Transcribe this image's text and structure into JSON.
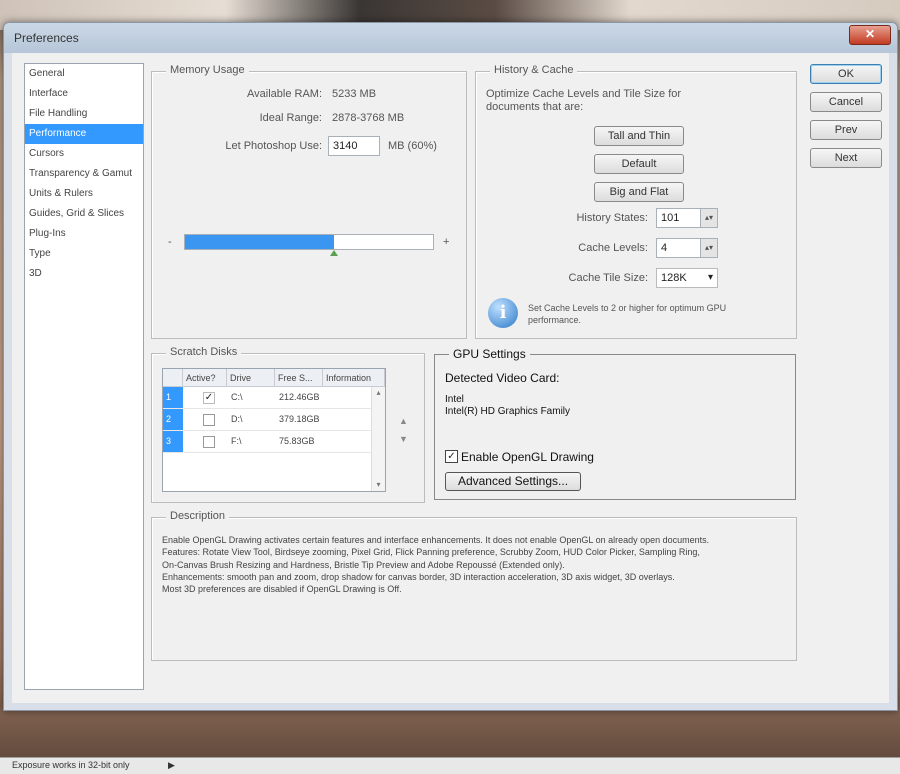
{
  "window": {
    "title": "Preferences",
    "close_glyph": "✕"
  },
  "nav": {
    "items": [
      "General",
      "Interface",
      "File Handling",
      "Performance",
      "Cursors",
      "Transparency & Gamut",
      "Units & Rulers",
      "Guides, Grid & Slices",
      "Plug-Ins",
      "Type",
      "3D"
    ],
    "selected": "Performance"
  },
  "memory": {
    "title": "Memory Usage",
    "available_label": "Available RAM:",
    "available_value": "5233 MB",
    "ideal_label": "Ideal Range:",
    "ideal_value": "2878-3768 MB",
    "let_label": "Let Photoshop Use:",
    "let_value": "3140",
    "let_unit": "MB (60%)",
    "minus": "-",
    "plus": "+",
    "slider_fraction": 0.6
  },
  "history": {
    "title": "History & Cache",
    "intro": "Optimize Cache Levels and Tile Size for documents that are:",
    "btn_tall": "Tall and Thin",
    "btn_default": "Default",
    "btn_big": "Big and Flat",
    "states_label": "History States:",
    "states_value": "101",
    "levels_label": "Cache Levels:",
    "levels_value": "4",
    "tile_label": "Cache Tile Size:",
    "tile_value": "128K",
    "info_text": "Set Cache Levels to 2 or higher for optimum GPU performance.",
    "spin_glyph": "▴▾",
    "dropdown_glyph": "▾"
  },
  "scratch": {
    "title": "Scratch Disks",
    "headers": [
      "Active?",
      "Drive",
      "Free S...",
      "Information"
    ],
    "rows": [
      {
        "num": "1",
        "active": true,
        "drive": "C:\\",
        "free": "212.46GB"
      },
      {
        "num": "2",
        "active": false,
        "drive": "D:\\",
        "free": "379.18GB"
      },
      {
        "num": "3",
        "active": false,
        "drive": "F:\\",
        "free": "75.83GB"
      }
    ],
    "check_glyph": "✓",
    "up_glyph": "▲",
    "down_glyph": "▼"
  },
  "gpu": {
    "title": "GPU Settings",
    "detected_label": "Detected Video Card:",
    "vendor": "Intel",
    "card": "Intel(R) HD Graphics Family",
    "opengl_label": "Enable OpenGL Drawing",
    "opengl_checked": true,
    "advanced_label": "Advanced Settings..."
  },
  "description": {
    "title": "Description",
    "lines": [
      "Enable OpenGL Drawing activates certain features and interface enhancements. It does not enable OpenGL on already open documents.",
      "Features: Rotate View Tool, Birdseye zooming, Pixel Grid, Flick Panning preference, Scrubby Zoom, HUD Color Picker, Sampling Ring,",
      "On-Canvas Brush Resizing and Hardness, Bristle Tip Preview and Adobe Repoussé (Extended only).",
      "Enhancements: smooth pan and zoom, drop shadow for canvas border, 3D interaction acceleration, 3D axis widget, 3D overlays.",
      "Most 3D preferences are disabled if OpenGL Drawing is Off."
    ]
  },
  "buttons": {
    "ok": "OK",
    "cancel": "Cancel",
    "prev": "Prev",
    "next": "Next"
  },
  "status": {
    "text": "Exposure works in 32-bit only",
    "arrow": "▶"
  }
}
